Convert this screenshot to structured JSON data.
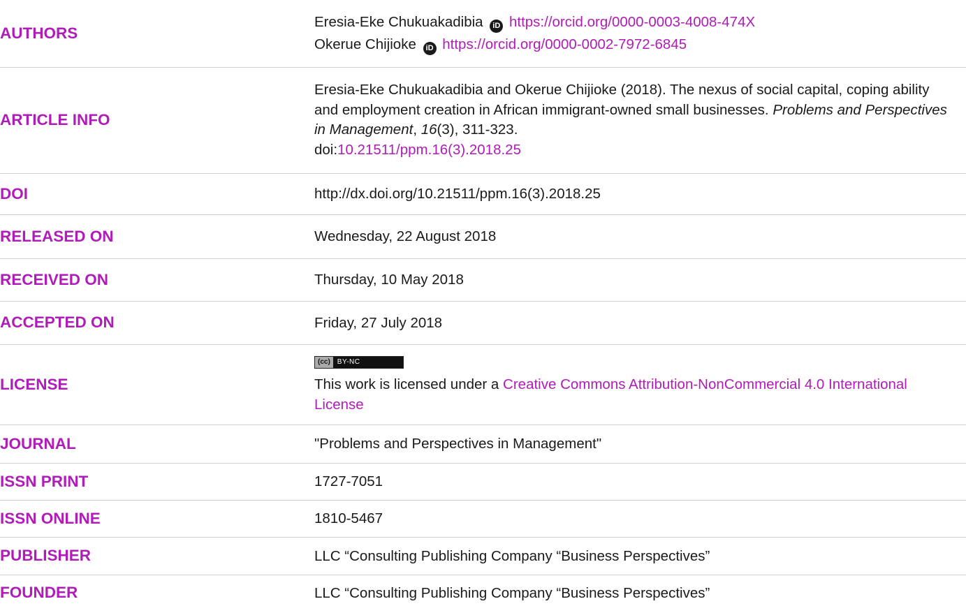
{
  "authors": {
    "label": "AUTHORS",
    "list": [
      {
        "name": "Eresia-Eke Chukuakadibia",
        "orcid_url": "https://orcid.org/0000-0003-4008-474X"
      },
      {
        "name": "Okerue Chijioke",
        "orcid_url": "https://orcid.org/0000-0002-7972-6845"
      }
    ]
  },
  "article_info": {
    "label": "ARTICLE INFO",
    "citation_prefix": "Eresia-Eke Chukuakadibia and Okerue Chijioke (2018). The nexus of social capital, coping ability and employment creation in African immigrant-owned small businesses. ",
    "journal_italic": "Problems and Perspectives in Management",
    "volume_sep": ", ",
    "volume_italic": "16",
    "citation_issue_pages": "(3), 311-323.",
    "doi_prefix": "doi:",
    "doi_link": "10.21511/ppm.16(3).2018.25"
  },
  "doi": {
    "label": "DOI",
    "value": "http://dx.doi.org/10.21511/ppm.16(3).2018.25"
  },
  "released_on": {
    "label": "RELEASED ON",
    "value": "Wednesday, 22 August 2018"
  },
  "received_on": {
    "label": "RECEIVED ON",
    "value": "Thursday, 10 May 2018"
  },
  "accepted_on": {
    "label": "ACCEPTED ON",
    "value": "Friday, 27 July 2018"
  },
  "license": {
    "label": "LICENSE",
    "badge_cc": "(cc)",
    "badge_text": "BY-NC",
    "text_prefix": "This work is licensed under a ",
    "link_text": "Creative Commons Attribution-NonCommercial 4.0 International License"
  },
  "journal": {
    "label": "JOURNAL",
    "value": "\"Problems and Perspectives in Management\""
  },
  "issn_print": {
    "label": "ISSN PRINT",
    "value": "1727-7051"
  },
  "issn_online": {
    "label": "ISSN ONLINE",
    "value": "1810-5467"
  },
  "publisher": {
    "label": "PUBLISHER",
    "value": "LLC “Consulting Publishing Company “Business Perspectives”"
  },
  "founder": {
    "label": "FOUNDER",
    "value": "LLC “Consulting Publishing Company “Business Perspectives”"
  },
  "colors": {
    "accent": "#b01cb8",
    "text": "#1a1a1a",
    "divider": "#cfcfcf"
  },
  "icons": {
    "orcid": "orcid-id-icon",
    "license_badge": "cc-by-nc-badge"
  }
}
